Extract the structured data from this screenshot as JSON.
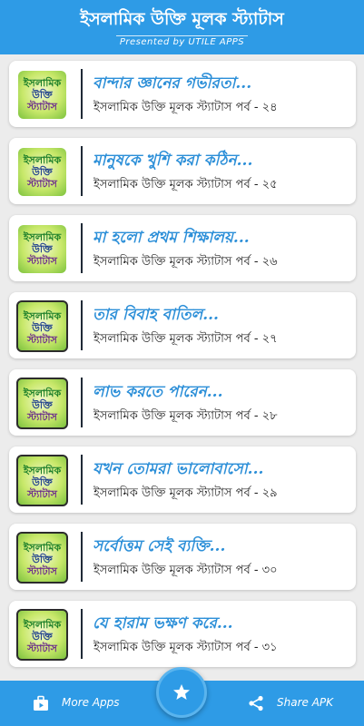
{
  "header": {
    "title": "ইসলামিক উক্তি মূলক স্ট্যাটাস",
    "subtitle": "Presented by UTILE APPS"
  },
  "thumbnail": {
    "line1": "ইসলামিক",
    "line2": "উক্তি",
    "line3": "স্ট্যাটাস"
  },
  "items": [
    {
      "title": "বান্দার জ্ঞানের গভীরতা...",
      "subtitle": "ইসলামিক উক্তি মূলক স্ট্যাটাস পর্ব - ২৪"
    },
    {
      "title": "মানুষকে খুশি করা কঠিন...",
      "subtitle": "ইসলামিক উক্তি মূলক স্ট্যাটাস পর্ব - ২৫"
    },
    {
      "title": "মা হলো প্রথম শিক্ষালয়...",
      "subtitle": "ইসলামিক উক্তি মূলক স্ট্যাটাস পর্ব - ২৬"
    },
    {
      "title": "তার বিবাহ বাতিল...",
      "subtitle": "ইসলামিক উক্তি মূলক স্ট্যাটাস পর্ব - ২৭"
    },
    {
      "title": "লাভ করতে পারেন...",
      "subtitle": "ইসলামিক উক্তি মূলক স্ট্যাটাস পর্ব - ২৮"
    },
    {
      "title": "যখন তোমরা ভালোবাসো...",
      "subtitle": "ইসলামিক উক্তি মূলক স্ট্যাটাস পর্ব - ২৯"
    },
    {
      "title": "সর্বোত্তম সেই ব্যক্তি...",
      "subtitle": "ইসলামিক উক্তি মূলক স্ট্যাটাস পর্ব - ৩০"
    },
    {
      "title": "যে হারাম ভক্ষণ করে...",
      "subtitle": "ইসলামিক উক্তি মূলক স্ট্যাটাস পর্ব - ৩১"
    }
  ],
  "bottom_bar": {
    "more_apps_label": "More Apps",
    "share_label": "Share APK",
    "more_apps_icon": "apps-bag-icon",
    "share_icon": "share-icon",
    "fab_icon": "star-icon"
  },
  "colors": {
    "accent": "#2e9be6",
    "title_text": "#2c8fd8",
    "background": "#ececec"
  }
}
